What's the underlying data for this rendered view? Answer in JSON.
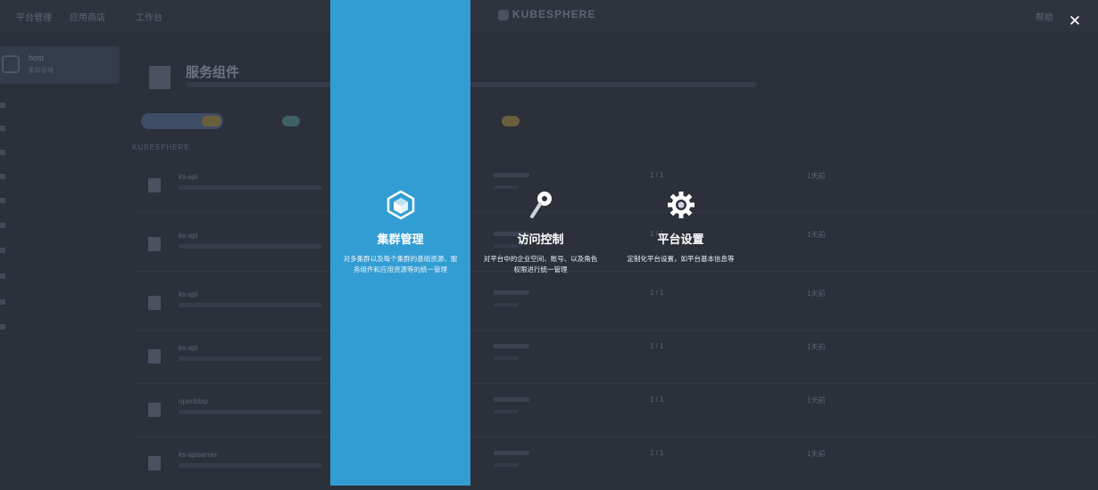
{
  "topbar": {
    "nav_items": [
      "平台管理",
      "应用商店",
      "工作台"
    ],
    "logo_text": "KUBESPHERE",
    "right_items": [
      "帮助"
    ]
  },
  "sidebar": {
    "cluster_name": "host",
    "cluster_sub": "集群管理"
  },
  "page": {
    "title": "服务组件"
  },
  "background_section_label": "KUBESPHERE",
  "background_rows": [
    {
      "name": "ks-api",
      "metric": "1 / 1",
      "time": "1天前"
    },
    {
      "name": "ks-api",
      "metric": "1 / 1",
      "time": "1天前"
    },
    {
      "name": "ks-api",
      "metric": "1 / 1",
      "time": "1天前"
    },
    {
      "name": "ks-api",
      "metric": "1 / 1",
      "time": "1天前"
    },
    {
      "name": "openldap",
      "metric": "1 / 1",
      "time": "1天前"
    },
    {
      "name": "ks-apiserver",
      "metric": "1 / 1",
      "time": "1天前"
    }
  ],
  "overlay": {
    "entries": [
      {
        "icon": "cluster-cube-icon",
        "title": "集群管理",
        "desc": "对多集群以及每个集群的基础资源、服务组件和应用资源等的统一管理",
        "active": true
      },
      {
        "icon": "key-icon",
        "title": "访问控制",
        "desc": "对平台中的企业空间、账号、以及角色权限进行统一管理",
        "active": false
      },
      {
        "icon": "gear-icon",
        "title": "平台设置",
        "desc": "定制化平台设置，如平台基本信息等",
        "active": false
      }
    ],
    "close_icon": "close-icon"
  },
  "colors": {
    "overlay_bg": "#2b303b",
    "active_panel": "#329dd2",
    "text_white": "#ffffff"
  }
}
